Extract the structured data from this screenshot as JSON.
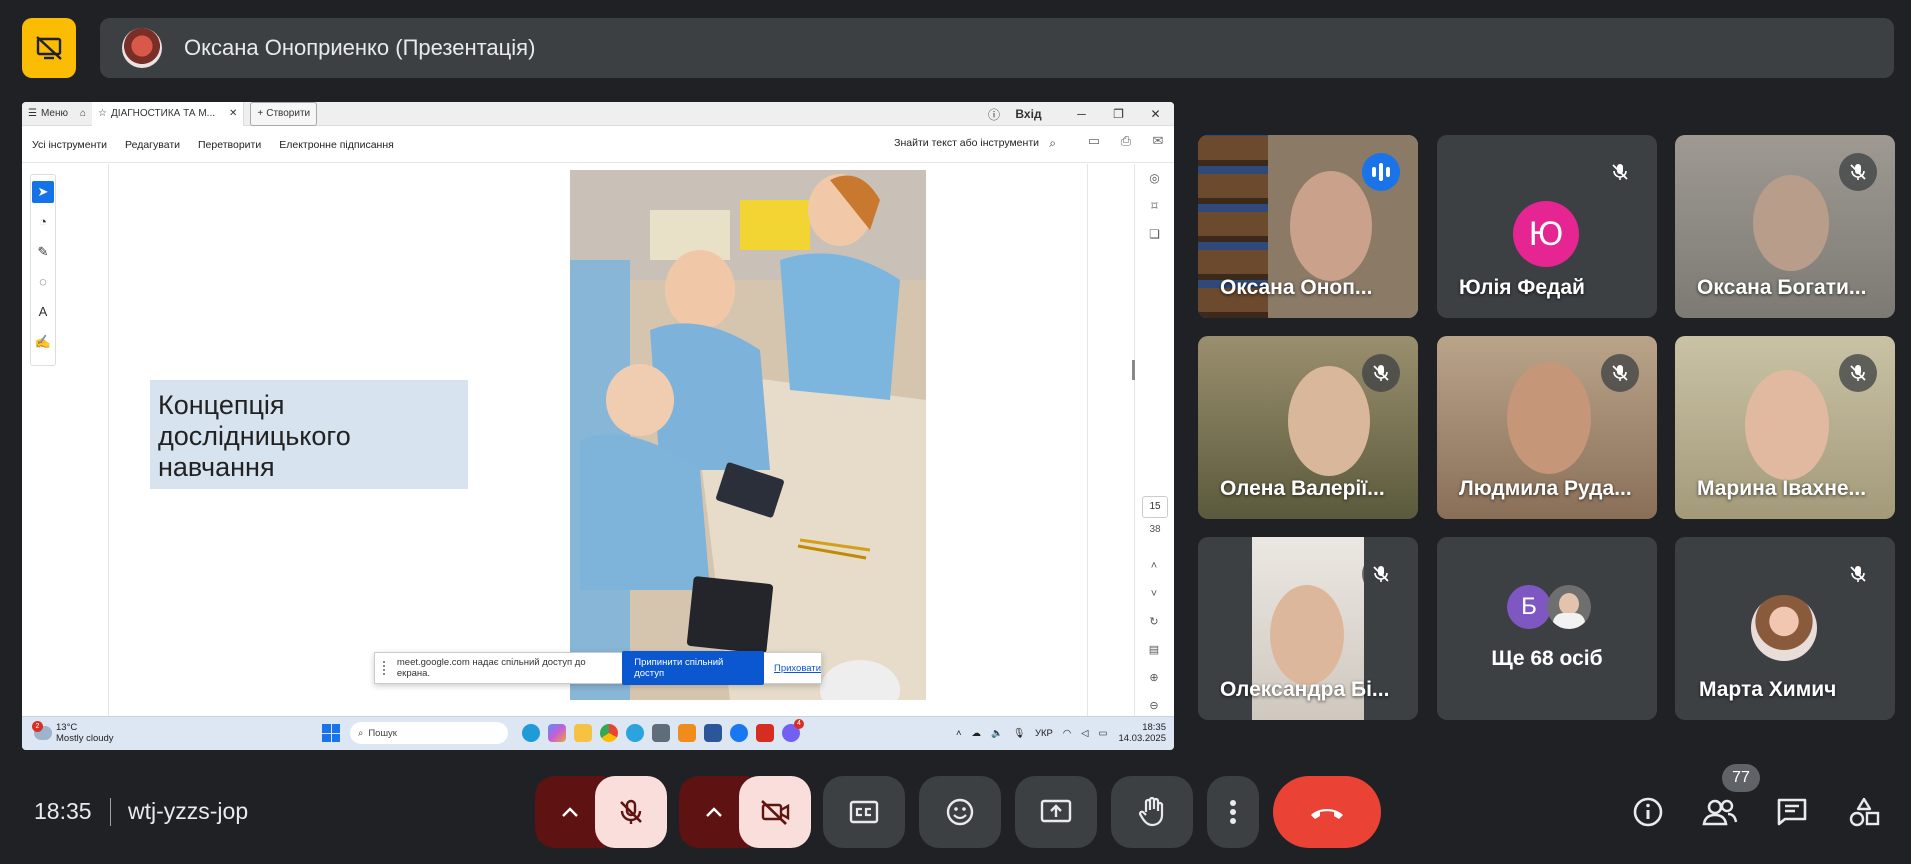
{
  "header": {
    "presenter_title": "Оксана Оноприенко (Презентація)"
  },
  "shared_screen": {
    "tabs": {
      "menu": "Меню",
      "doc_tab": "ДІАГНОСТИКА ТА М...",
      "create": "Створити",
      "login": "Вхід"
    },
    "menu": [
      "Усі інструменти",
      "Редагувати",
      "Перетворити",
      "Електронне підписання"
    ],
    "find_text": "Знайти текст або інструменти",
    "slide_title": "Концепція дослідницького навчання",
    "page_current": "15",
    "page_total": "38",
    "share_notice": {
      "text": "meet.google.com надає спільний доступ до екрана.",
      "stop": "Припинити спільний доступ",
      "hide": "Приховати"
    },
    "taskbar": {
      "temp": "13°C",
      "weather": "Mostly cloudy",
      "weather_badge": "2",
      "search": "Пошук",
      "lang": "УКР",
      "time": "18:35",
      "date": "14.03.2025",
      "app_badge": "4"
    }
  },
  "participants": [
    {
      "name": "Оксана Оноп...",
      "state": "speaking"
    },
    {
      "name": "Юлія Федай",
      "initial": "Ю",
      "state": "muted"
    },
    {
      "name": "Оксана Богати...",
      "state": "muted"
    },
    {
      "name": "Олена Валерії...",
      "state": "muted"
    },
    {
      "name": "Людмила Руда...",
      "state": "muted"
    },
    {
      "name": "Марина Івахне...",
      "state": "muted"
    },
    {
      "name": "Олександра Бі...",
      "state": "muted"
    },
    {
      "name": "Ще 68 осіб",
      "initial": "Б"
    },
    {
      "name": "Марта Химич",
      "state": "muted"
    }
  ],
  "footer": {
    "time": "18:35",
    "meeting_code": "wtj-yzzs-jop",
    "participant_count": "77"
  },
  "colors": {
    "background": "#202124",
    "stop_share": "#fbbc04",
    "hangup": "#ea4335",
    "active_outline": "#8ab4f8",
    "muted_pink": "#f9dedc"
  }
}
